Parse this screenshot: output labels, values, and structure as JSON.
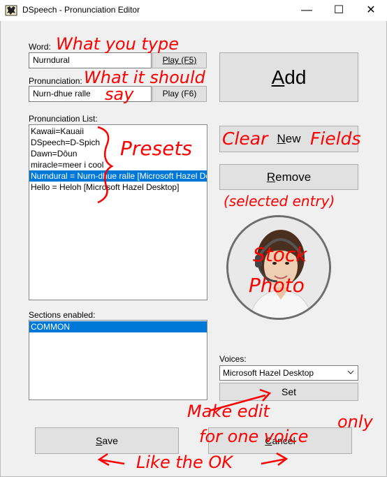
{
  "window": {
    "title": "DSpeech - Pronunciation Editor",
    "minimize": "—",
    "maximize": "☐",
    "close": "✕"
  },
  "word": {
    "label": "Word:",
    "value": "Nurndural",
    "play_label": "Play (F5)"
  },
  "pronunciation": {
    "label": "Pronunciation:",
    "value": "Nurn-dhue ralle",
    "play_label": "Play (F6)"
  },
  "add_button": {
    "prefix": "",
    "accel": "A",
    "rest": "dd"
  },
  "new_button": {
    "prefix": "",
    "accel": "N",
    "rest": "ew"
  },
  "remove_button": {
    "prefix": "",
    "accel": "R",
    "rest": "emove"
  },
  "pronunciation_list": {
    "label": "Pronunciation List:",
    "items": [
      "Kawaii=Kauaiì",
      "DSpeech=D-Spich",
      "Dawn=Dôun",
      "miracle=meer i cool",
      "Nurndural = Nurn-dhue ralle [Microsoft Hazel Desktop]",
      "Hello = Heloh [Microsoft Hazel Desktop]"
    ],
    "selected_index": 4
  },
  "sections": {
    "label": "Sections enabled:",
    "items": [
      "COMMON"
    ]
  },
  "voices": {
    "label": "Voices:",
    "selected": "Microsoft Hazel Desktop",
    "set_label": "Set"
  },
  "save_button": {
    "prefix": "",
    "accel": "S",
    "rest": "ave"
  },
  "cancel_button": {
    "prefix": "",
    "accel": "C",
    "rest": "ancel"
  },
  "annotations": {
    "word": "What you type",
    "pronunciation_1": "What it should",
    "pronunciation_2": "say",
    "presets": "Presets",
    "clear_1": "Clear",
    "clear_2": "Fields",
    "selected": "(selected entry)",
    "stock_1": "Stock",
    "stock_2": "Photo",
    "make_edit_1": "Make edit",
    "make_edit_2": "only",
    "one_voice": "for one voice",
    "like_ok": "Like the OK"
  },
  "colors": {
    "annotation": "#ff0000",
    "selection": "#0078d7"
  },
  "icons": {
    "app": "dspeech-app-icon",
    "dropdown": "chevron-down-icon",
    "arrow": "hand-drawn-arrow-icon"
  }
}
